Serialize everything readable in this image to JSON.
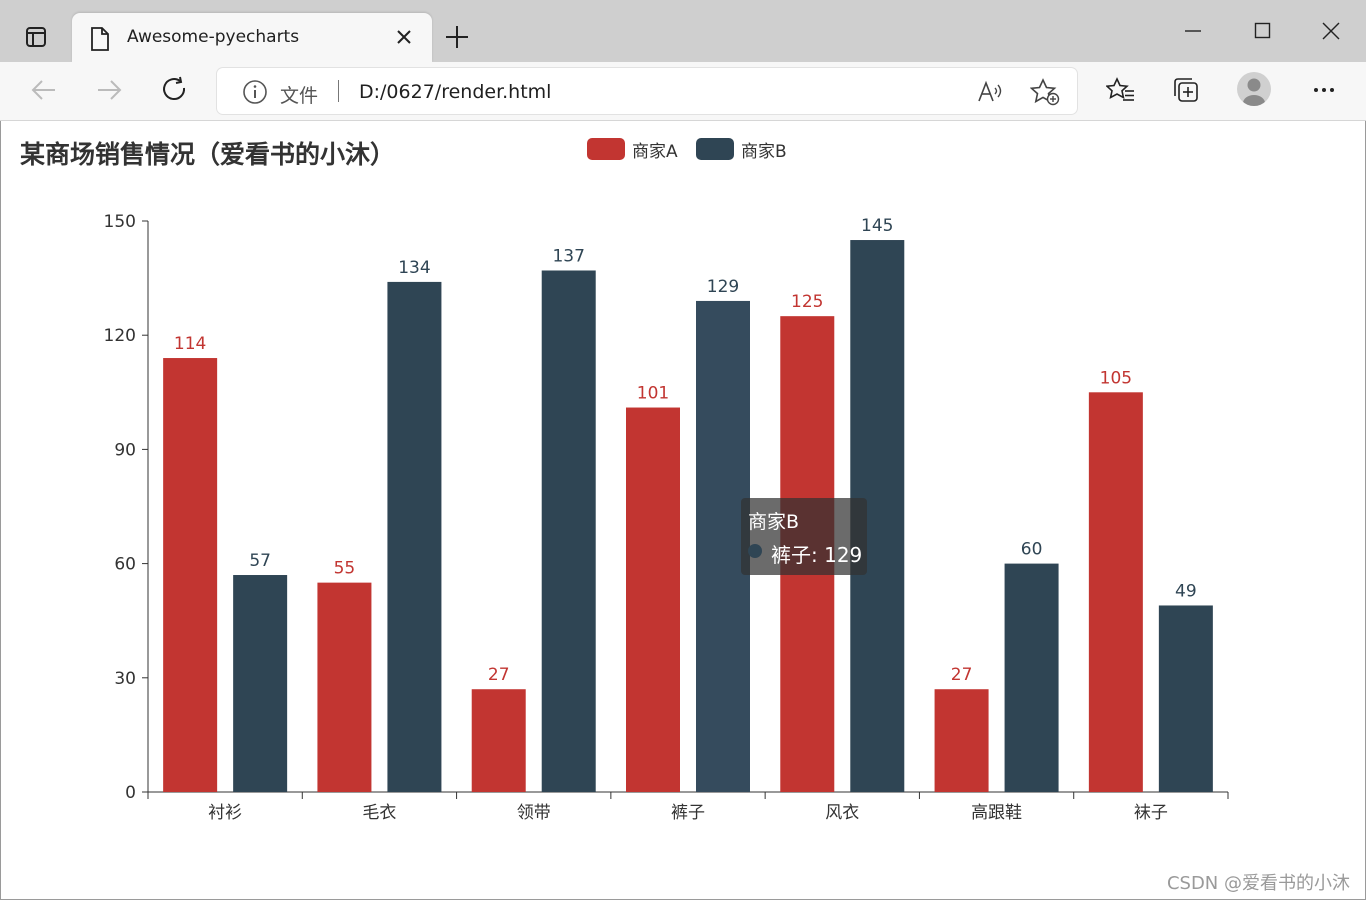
{
  "browser": {
    "tab_title": "Awesome-pyecharts",
    "address_prefix": "文件",
    "url": "D:/0627/render.html"
  },
  "colors": {
    "series_a": "#c23531",
    "series_b": "#2f4554",
    "axis": "#333333",
    "label": "#333333"
  },
  "chart_data": {
    "type": "bar",
    "title": "某商场销售情况（爱看书的小沐）",
    "categories": [
      "衬衫",
      "毛衣",
      "领带",
      "裤子",
      "风衣",
      "高跟鞋",
      "袜子"
    ],
    "series": [
      {
        "name": "商家A",
        "values": [
          114,
          55,
          27,
          101,
          125,
          27,
          105
        ]
      },
      {
        "name": "商家B",
        "values": [
          57,
          134,
          137,
          129,
          145,
          60,
          49
        ]
      }
    ],
    "ylim": [
      0,
      150
    ],
    "yticks": [
      0,
      30,
      60,
      90,
      120,
      150
    ],
    "legend_position": "top",
    "grid": false,
    "data_labels": true
  },
  "tooltip": {
    "series": "商家B",
    "text": "裤子: 129"
  },
  "watermark": "CSDN @爱看书的小沐"
}
